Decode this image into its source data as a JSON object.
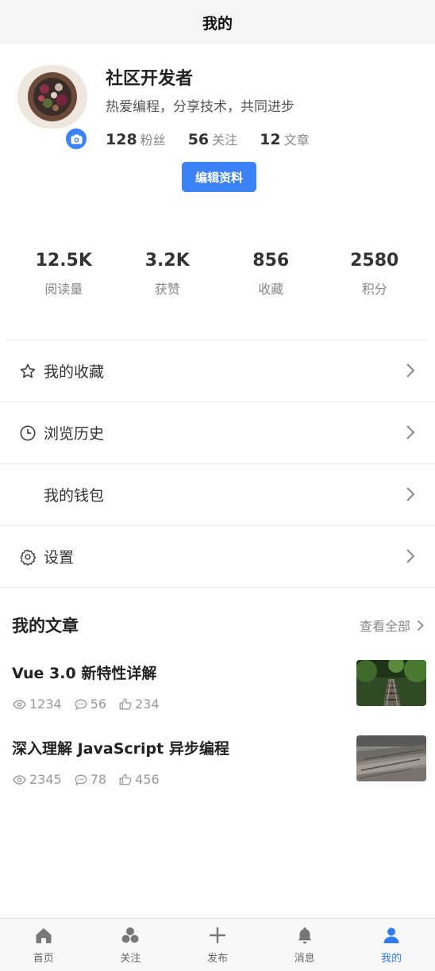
{
  "navbar": {
    "title": "我的"
  },
  "profile": {
    "name": "社区开发者",
    "bio": "热爱编程，分享技术，共同进步",
    "counts": [
      {
        "value": "128",
        "label": "粉丝"
      },
      {
        "value": "56",
        "label": "关注"
      },
      {
        "value": "12",
        "label": "文章"
      }
    ],
    "edit_label": "编辑资料"
  },
  "stats": [
    {
      "value": "12.5K",
      "label": "阅读量"
    },
    {
      "value": "3.2K",
      "label": "获赞"
    },
    {
      "value": "856",
      "label": "收藏"
    },
    {
      "value": "2580",
      "label": "积分"
    }
  ],
  "menu": [
    {
      "label": "我的收藏",
      "icon": "star-icon"
    },
    {
      "label": "浏览历史",
      "icon": "clock-icon"
    },
    {
      "label": "我的钱包",
      "icon": ""
    },
    {
      "label": "设置",
      "icon": "gear-icon"
    }
  ],
  "articles": {
    "title": "我的文章",
    "view_all": "查看全部",
    "items": [
      {
        "title": "Vue 3.0 新特性详解",
        "views": "1234",
        "comments": "56",
        "likes": "234"
      },
      {
        "title": "深入理解 JavaScript 异步编程",
        "views": "2345",
        "comments": "78",
        "likes": "456"
      }
    ]
  },
  "tabbar": [
    {
      "label": "首页",
      "icon": "home-icon"
    },
    {
      "label": "关注",
      "icon": "follow-icon"
    },
    {
      "label": "发布",
      "icon": "plus-icon"
    },
    {
      "label": "消息",
      "icon": "bell-icon"
    },
    {
      "label": "我的",
      "icon": "user-icon",
      "active": true
    }
  ],
  "colors": {
    "accent": "#3b82f6",
    "tab_active": "#2f7bf3"
  }
}
